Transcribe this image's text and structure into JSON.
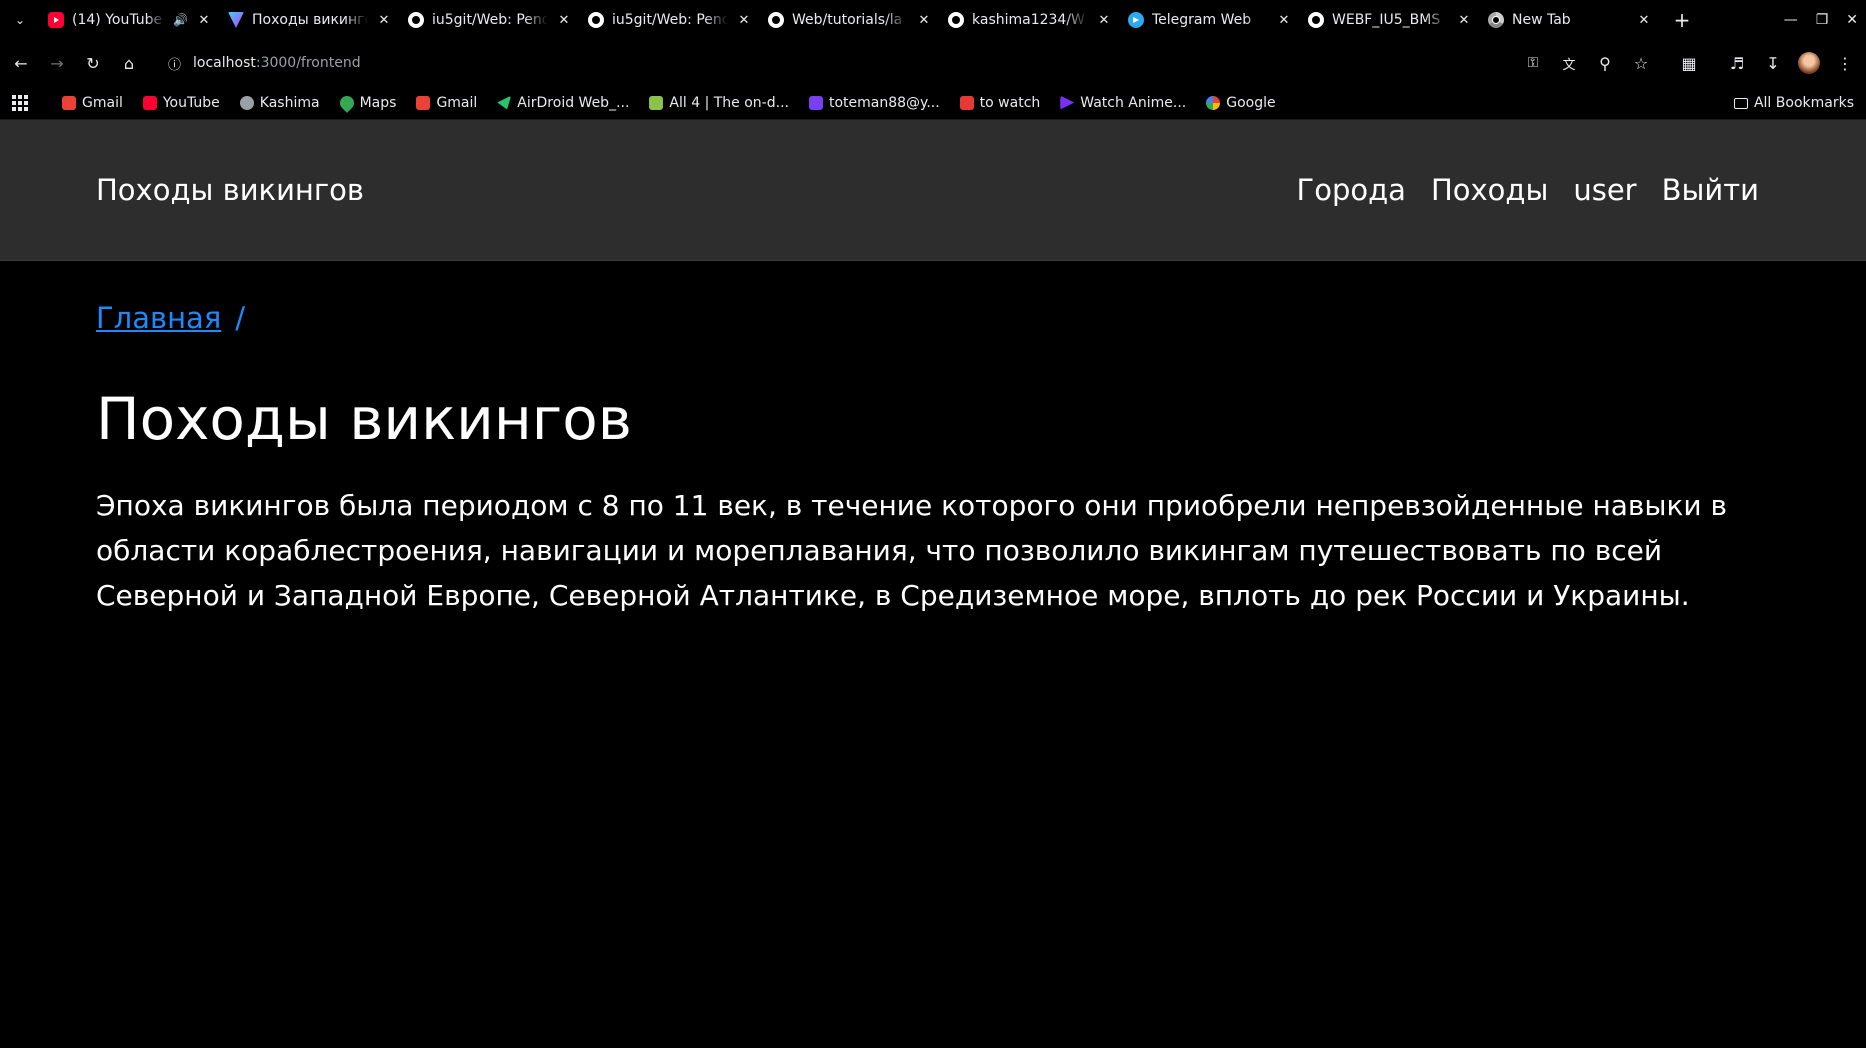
{
  "browser": {
    "tabs": [
      {
        "title": "(14) YouTube",
        "favicon": "youtube-icon",
        "audio": true
      },
      {
        "title": "Походы викингов",
        "favicon": "vite-icon",
        "active": true
      },
      {
        "title": "iu5git/Web: Pend",
        "favicon": "github-icon"
      },
      {
        "title": "iu5git/Web: Pend",
        "favicon": "github-icon"
      },
      {
        "title": "Web/tutorials/la",
        "favicon": "github-icon"
      },
      {
        "title": "kashima1234/W",
        "favicon": "github-icon"
      },
      {
        "title": "Telegram Web",
        "favicon": "telegram-icon"
      },
      {
        "title": "WEBF_IU5_BMS",
        "favicon": "github-icon"
      },
      {
        "title": "New Tab",
        "favicon": "chrome-icon"
      }
    ],
    "url": {
      "host": "localhost",
      "path": ":3000/frontend"
    },
    "bookmarks": [
      {
        "label": "Gmail",
        "color": "#ea4335"
      },
      {
        "label": "YouTube",
        "color": "#ff0033"
      },
      {
        "label": "Kashima",
        "color": "#9aa0a6"
      },
      {
        "label": "Maps",
        "color": "#34a853"
      },
      {
        "label": "Gmail",
        "color": "#ea4335"
      },
      {
        "label": "AirDroid Web_...",
        "color": "#27c26a"
      },
      {
        "label": "All 4 | The on-d...",
        "color": "#8bc34a"
      },
      {
        "label": "toteman88@y...",
        "color": "#7b3ff2"
      },
      {
        "label": "to watch",
        "color": "#e53935"
      },
      {
        "label": "Watch Anime...",
        "color": "#7b2ff7"
      },
      {
        "label": "Google",
        "color": "#4285f4"
      }
    ],
    "all_bookmarks": "All Bookmarks"
  },
  "header": {
    "brand": "Походы викингов",
    "nav": [
      "Города",
      "Походы",
      "user",
      "Выйти"
    ]
  },
  "breadcrumb": {
    "home": "Главная",
    "separator": "/"
  },
  "main": {
    "title": "Походы викингов",
    "lead": "Эпоха викингов была периодом с 8 по 11 век, в течение которого они приобрели непревзойденные навыки в области кораблестроения, навигации и мореплавания, что позволило викингам путешествовать по всей Северной и Западной Европе, Северной Атлантике, в Средиземное море, вплоть до рек России и Украины."
  }
}
